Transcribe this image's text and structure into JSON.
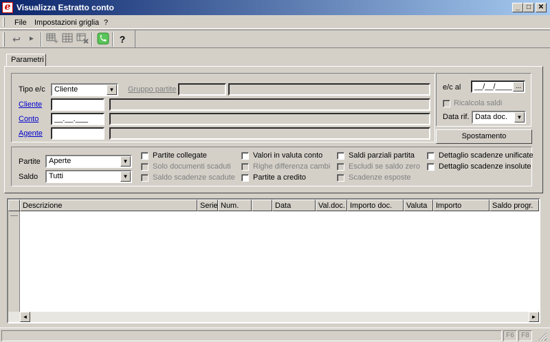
{
  "window": {
    "title": "Visualizza Estratto conto",
    "app_icon": "e",
    "minimize": "_",
    "maximize": "□",
    "close": "✕"
  },
  "menu": [
    "File",
    "Impostazioni griglia",
    "?"
  ],
  "toolbar": {
    "icons": [
      "undo-arrow-icon",
      "play-arrow-icon",
      "grid-add-icon",
      "grid-icon",
      "grid-remove-icon",
      "phone-icon",
      "help-icon"
    ],
    "help_glyph": "?"
  },
  "tab": {
    "label": "Parametri"
  },
  "filters": {
    "tipo_label": "Tipo e/c",
    "tipo_value": "Cliente",
    "gruppo_label": "Gruppo partite",
    "cliente_label": "Cliente",
    "conto_label": "Conto",
    "conto_value": "__.__.___",
    "agente_label": "Agente"
  },
  "date_panel": {
    "ec_al_label": "e/c al",
    "ec_al_value": "__/__/____",
    "ec_al_button": "...",
    "ricalcola_label": "Ricalcola saldi",
    "data_rif_label": "Data rif.",
    "data_rif_value": "Data doc.",
    "spostamento_label": "Spostamento"
  },
  "options": {
    "partite_label": "Partite",
    "partite_value": "Aperte",
    "saldo_label": "Saldo",
    "saldo_value": "Tutti",
    "checkboxes": [
      {
        "label": "Partite collegate",
        "enabled": true
      },
      {
        "label": "Solo documenti scaduti",
        "enabled": false
      },
      {
        "label": "Saldo scadenze scadute",
        "enabled": false
      },
      {
        "label": "Valori in valuta conto",
        "enabled": true
      },
      {
        "label": "Righe differenza cambi",
        "enabled": false
      },
      {
        "label": "Partite a credito",
        "enabled": true
      },
      {
        "label": "Saldi parziali partita",
        "enabled": true
      },
      {
        "label": "Escludi se saldo zero",
        "enabled": false
      },
      {
        "label": "Scadenze esposte",
        "enabled": false
      },
      {
        "label": "Dettaglio scadenze unificate",
        "enabled": true
      },
      {
        "label": "Dettaglio scadenze insolute",
        "enabled": true
      }
    ]
  },
  "grid": {
    "columns": [
      "Descrizione",
      "Serie",
      "Num.",
      "",
      "Data",
      "Val.doc.",
      "Importo doc.",
      "Valuta",
      "Importo",
      "Saldo progr."
    ],
    "rows": []
  },
  "statusbar": {
    "keys": [
      "F6",
      "F8"
    ]
  }
}
